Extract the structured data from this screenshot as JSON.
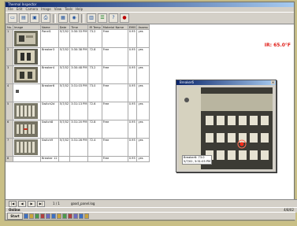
{
  "window": {
    "title": "Thermal Inspector",
    "menu": [
      "File",
      "Edit",
      "Camera",
      "Image",
      "View",
      "Tools",
      "Help"
    ]
  },
  "toolbar": {
    "icons": [
      "new-icon",
      "open-icon",
      "save-icon",
      "print-icon",
      "grid-icon",
      "camera-icon",
      "image-icon",
      "report-icon",
      "help-icon",
      "info-icon"
    ]
  },
  "table": {
    "headers": [
      "No.",
      "Image",
      "Name",
      "Date",
      "Time",
      "IR Temp",
      "Material Name",
      "EMIS",
      "Assess"
    ],
    "rows": [
      {
        "no": "1",
        "name": "Panel1",
        "date": "5/7/02",
        "time": "3:30:33 PM",
        "temp": "73.2",
        "material": "Free",
        "emis": "0.95",
        "assess": "yes"
      },
      {
        "no": "2",
        "name": "Breaker3",
        "date": "5/7/02",
        "time": "3:30:38 PM",
        "temp": "72.8",
        "material": "Free",
        "emis": "0.95",
        "assess": "yes"
      },
      {
        "no": "3",
        "name": "Breaker4",
        "date": "5/7/02",
        "time": "3:30:48 PM",
        "temp": "73.2",
        "material": "Free",
        "emis": "0.95",
        "assess": "yes"
      },
      {
        "no": "4",
        "name": "Breaker6",
        "date": "5/7/02",
        "time": "3:31:03 PM",
        "temp": "73.0",
        "material": "Free",
        "emis": "0.95",
        "assess": "yes"
      },
      {
        "no": "5",
        "name": "Switch2d",
        "date": "5/7/02",
        "time": "3:31:13 PM",
        "temp": "72.6",
        "material": "Free",
        "emis": "0.95",
        "assess": "yes"
      },
      {
        "no": "6",
        "name": "Switch8",
        "date": "5/7/02",
        "time": "3:31:20 PM",
        "temp": "72.8",
        "material": "Free",
        "emis": "0.95",
        "assess": "yes"
      },
      {
        "no": "7",
        "name": "Switch9",
        "date": "5/7/02",
        "time": "3:31:28 PM",
        "temp": "72.4",
        "material": "Free",
        "emis": "0.95",
        "assess": "yes"
      }
    ],
    "empty_row": {
      "no": "8",
      "name": "Breaker 12",
      "material": "Free",
      "emis": "0.95",
      "assess": "yes"
    }
  },
  "temperature_readout": "IR: 65.0°F",
  "popup": {
    "title": "Breaker6",
    "caption_line1": "Breaker6: 73.0",
    "caption_line2": "5/7/02, 3:31:03 PM"
  },
  "navigation": {
    "record": "1 / 1",
    "filename": "good_panel.log"
  },
  "status": {
    "left": "Online",
    "right": "4/8/02"
  },
  "taskbar": {
    "start": "Start"
  },
  "colors": {
    "background": "#c9bf86",
    "titlebar": "#0a246a",
    "readout": "#e0201a"
  }
}
